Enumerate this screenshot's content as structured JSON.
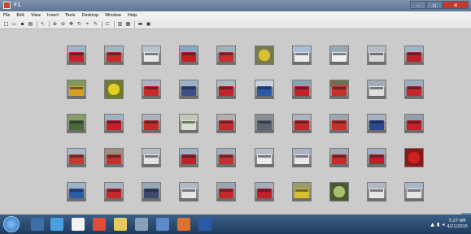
{
  "window": {
    "title": "F1",
    "icon": "figure-window-icon",
    "buttons": [
      "–",
      "▫",
      "✕"
    ]
  },
  "menubar": {
    "items": [
      "File",
      "Edit",
      "View",
      "Insert",
      "Tools",
      "Desktop",
      "Window",
      "Help"
    ]
  },
  "toolbar": {
    "buttons": [
      {
        "icon": "new-figure-icon",
        "glyph": "□"
      },
      {
        "icon": "open-file-icon",
        "glyph": "▭"
      },
      {
        "icon": "save-icon",
        "glyph": "▪"
      },
      {
        "icon": "print-icon",
        "glyph": "▤"
      },
      {
        "sep": true
      },
      {
        "icon": "pointer-icon",
        "glyph": "↖"
      },
      {
        "sep": true
      },
      {
        "icon": "zoom-in-icon",
        "glyph": "⊕"
      },
      {
        "icon": "zoom-out-icon",
        "glyph": "⊖"
      },
      {
        "icon": "pan-icon",
        "glyph": "✥"
      },
      {
        "icon": "rotate-icon",
        "glyph": "↻"
      },
      {
        "icon": "data-cursor-icon",
        "glyph": "⌖"
      },
      {
        "icon": "brush-icon",
        "glyph": "✎"
      },
      {
        "sep": true
      },
      {
        "icon": "link-icon",
        "glyph": "⊏"
      },
      {
        "sep": true
      },
      {
        "icon": "colorbar-icon",
        "glyph": "▥"
      },
      {
        "icon": "legend-icon",
        "glyph": "▦"
      },
      {
        "sep": true
      },
      {
        "icon": "hide-tools-icon",
        "glyph": "▬"
      },
      {
        "icon": "dock-icon",
        "glyph": "▣"
      }
    ]
  },
  "grid": {
    "rows": 5,
    "cols": 10,
    "thumbnails": [
      {
        "sky": "#9fb3c7",
        "bus": "#c8202a",
        "kind": "bus"
      },
      {
        "sky": "#a8b4bf",
        "bus": "#c42a2a",
        "kind": "bus"
      },
      {
        "sky": "#b9c3cc",
        "bus": "#e8e8e8",
        "kind": "bus"
      },
      {
        "sky": "#8aa7c2",
        "bus": "#c51f24",
        "kind": "bus"
      },
      {
        "sky": "#a5b0b8",
        "bus": "#c63030",
        "kind": "bus"
      },
      {
        "sky": "#7a7a50",
        "bus": "#d8c030",
        "kind": "flower"
      },
      {
        "sky": "#a9bfd6",
        "bus": "#ececec",
        "kind": "bus"
      },
      {
        "sky": "#9aa9b8",
        "bus": "#f0f0f0",
        "kind": "bus"
      },
      {
        "sky": "#b5bec8",
        "bus": "#d7d7d7",
        "kind": "bus"
      },
      {
        "sky": "#a3b2c4",
        "bus": "#c01f28",
        "kind": "bus"
      },
      {
        "sky": "#7f9a5a",
        "bus": "#d9a020",
        "kind": "bus"
      },
      {
        "sky": "#6d7a30",
        "bus": "#e4d020",
        "kind": "flower"
      },
      {
        "sky": "#a7b5c2",
        "bus": "#c92a2a",
        "kind": "bus"
      },
      {
        "sky": "#9fb0c4",
        "bus": "#3c4f8a",
        "kind": "bus"
      },
      {
        "sky": "#b0b8c0",
        "bus": "#c4222a",
        "kind": "bus"
      },
      {
        "sky": "#c8d0d8",
        "bus": "#2c5aa8",
        "kind": "bus"
      },
      {
        "sky": "#8ea0b2",
        "bus": "#c42028",
        "kind": "bus"
      },
      {
        "sky": "#7a6a50",
        "bus": "#c8302a",
        "kind": "bus"
      },
      {
        "sky": "#a2adb8",
        "bus": "#e0e0e0",
        "kind": "bus"
      },
      {
        "sky": "#9aaec4",
        "bus": "#c82430",
        "kind": "bus"
      },
      {
        "sky": "#8a9a6a",
        "bus": "#4a6a3a",
        "kind": "bus"
      },
      {
        "sky": "#9fb3c7",
        "bus": "#c8202a",
        "kind": "bus"
      },
      {
        "sky": "#a8b4bf",
        "bus": "#c42a2a",
        "kind": "bus"
      },
      {
        "sky": "#c0c8b8",
        "bus": "#d8e0d0",
        "kind": "bus"
      },
      {
        "sky": "#b0b0b0",
        "bus": "#c42a2a",
        "kind": "bus"
      },
      {
        "sky": "#8a8f96",
        "bus": "#5c6470",
        "kind": "bus"
      },
      {
        "sky": "#a9b6c4",
        "bus": "#c22a2a",
        "kind": "bus"
      },
      {
        "sky": "#9aa6b2",
        "bus": "#c8302a",
        "kind": "bus"
      },
      {
        "sky": "#a6b2be",
        "bus": "#2a4a90",
        "kind": "bus"
      },
      {
        "sky": "#8fa0b0",
        "bus": "#c42028",
        "kind": "bus"
      },
      {
        "sky": "#a8b8c8",
        "bus": "#c83a2a",
        "kind": "bus"
      },
      {
        "sky": "#9a8f80",
        "bus": "#c4302a",
        "kind": "bus"
      },
      {
        "sky": "#b3bcc6",
        "bus": "#e4e4e4",
        "kind": "bus"
      },
      {
        "sky": "#9fb0c0",
        "bus": "#c42028",
        "kind": "bus"
      },
      {
        "sky": "#a2aeba",
        "bus": "#c63030",
        "kind": "bus"
      },
      {
        "sky": "#b4bec8",
        "bus": "#ececec",
        "kind": "bus"
      },
      {
        "sky": "#a9b4c0",
        "bus": "#e8e8e8",
        "kind": "bus"
      },
      {
        "sky": "#a0aab4",
        "bus": "#c82a2a",
        "kind": "bus"
      },
      {
        "sky": "#9aaec4",
        "bus": "#c01f28",
        "kind": "bus"
      },
      {
        "sky": "#8a1a1a",
        "bus": "#d02020",
        "kind": "flower"
      },
      {
        "sky": "#9fb3c7",
        "bus": "#2a5aa8",
        "kind": "bus"
      },
      {
        "sky": "#a8b4bf",
        "bus": "#c42a2a",
        "kind": "bus"
      },
      {
        "sky": "#9aa8b6",
        "bus": "#3a4a6a",
        "kind": "bus"
      },
      {
        "sky": "#b0bac4",
        "bus": "#e6e6e6",
        "kind": "bus"
      },
      {
        "sky": "#9aa6b2",
        "bus": "#c42a2a",
        "kind": "bus"
      },
      {
        "sky": "#a5b0bc",
        "bus": "#c4202a",
        "kind": "bus"
      },
      {
        "sky": "#9a9a70",
        "bus": "#d8c030",
        "kind": "bus"
      },
      {
        "sky": "#4a5a30",
        "bus": "#a8c070",
        "kind": "flower"
      },
      {
        "sky": "#b0b8c2",
        "bus": "#e8e8e8",
        "kind": "bus"
      },
      {
        "sky": "#a8b6c6",
        "bus": "#e4e4e4",
        "kind": "bus"
      }
    ]
  },
  "taskbar": {
    "start_icon": "windows-start-icon",
    "apps": [
      {
        "icon": "explorer-icon",
        "color": "#3d6fa8"
      },
      {
        "icon": "ie-icon",
        "color": "#4aa0e0"
      },
      {
        "icon": "documents-icon",
        "color": "#f2f2f2"
      },
      {
        "icon": "chrome-icon",
        "color": "#e24a3a"
      },
      {
        "icon": "folder-icon",
        "color": "#e8c860"
      },
      {
        "icon": "app-icon",
        "color": "#8aa0b8"
      },
      {
        "icon": "app-icon-2",
        "color": "#5a8ac8"
      },
      {
        "icon": "matlab-icon",
        "color": "#e07030"
      },
      {
        "icon": "word-icon",
        "color": "#2a5aa8"
      }
    ],
    "clock_time": "5:27 AM",
    "clock_date": "4/21/2015"
  }
}
